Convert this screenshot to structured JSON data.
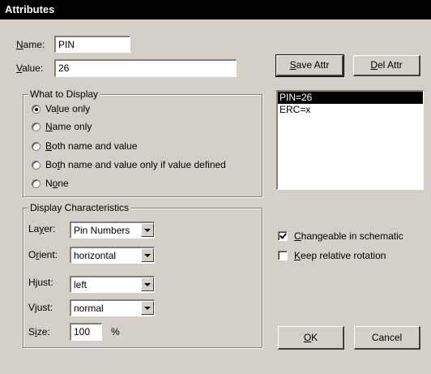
{
  "window": {
    "title": "Attributes"
  },
  "name": {
    "label_u": "N",
    "label_rest": "ame:",
    "value": "PIN"
  },
  "value": {
    "label_u": "V",
    "label_rest": "alue:",
    "value": "26"
  },
  "buttons": {
    "save_u": "S",
    "save_rest": "ave Attr",
    "del_u": "D",
    "del_rest": "el Attr",
    "ok_u": "O",
    "ok_rest": "K",
    "cancel": "Cancel"
  },
  "attr_list": {
    "items": [
      "PIN=26",
      "ERC=x"
    ],
    "selected_index": 0
  },
  "what_to_display": {
    "title": "What to Display",
    "options": [
      {
        "pre": "Va",
        "u": "l",
        "post": "ue only",
        "selected": true
      },
      {
        "pre": "",
        "u": "N",
        "post": "ame only",
        "selected": false
      },
      {
        "pre": "",
        "u": "B",
        "post": "oth name and value",
        "selected": false
      },
      {
        "pre": "Bo",
        "u": "t",
        "post": "h name and value only if value defined",
        "selected": false
      },
      {
        "pre": "N",
        "u": "o",
        "post": "ne",
        "selected": false
      }
    ]
  },
  "display_characteristics": {
    "title": "Display Characteristics",
    "layer": {
      "pre": "La",
      "u": "y",
      "post": "er:",
      "value": "Pin Numbers"
    },
    "orient": {
      "pre": "O",
      "u": "r",
      "post": "ient:",
      "value": "horizontal"
    },
    "hjust": {
      "pre": "H",
      "u": "j",
      "post": "ust:",
      "value": "left"
    },
    "vjust": {
      "pre": "V",
      "u": "j",
      "post": "ust:",
      "value": "normal"
    },
    "size": {
      "pre": "S",
      "u": "i",
      "post": "ze:",
      "value": "100",
      "unit": "%"
    }
  },
  "options": {
    "changeable": {
      "u": "C",
      "post": "hangeable in schematic",
      "checked": true
    },
    "keep_rotation": {
      "u": "K",
      "post": "eep relative rotation",
      "checked": false
    }
  }
}
